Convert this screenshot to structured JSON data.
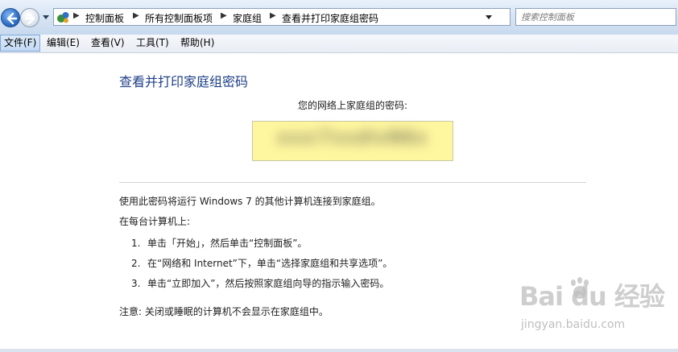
{
  "address_bar": {
    "breadcrumbs": [
      "控制面板",
      "所有控制面板项",
      "家庭组",
      "查看并打印家庭组密码"
    ],
    "search_placeholder": "搜索控制面板"
  },
  "menu": {
    "items": [
      {
        "label": "文件(F)",
        "active": true
      },
      {
        "label": "编辑(E)",
        "active": false
      },
      {
        "label": "查看(V)",
        "active": false
      },
      {
        "label": "工具(T)",
        "active": false
      },
      {
        "label": "帮助(H)",
        "active": false
      }
    ]
  },
  "content": {
    "title": "查看并打印家庭组密码",
    "password_label": "您的网络上家庭组的密码:",
    "password_value": "xxxi7xxdlxN6x",
    "intro": "使用此密码将运行 Windows 7 的其他计算机连接到家庭组。",
    "on_each": "在每台计算机上:",
    "steps": [
      {
        "num": "1.",
        "text": "单击「开始」，然后单击“控制面板”。"
      },
      {
        "num": "2.",
        "text": "在“网络和 Internet”下，单击“选择家庭组和共享选项”。"
      },
      {
        "num": "3.",
        "text": "单击“立即加入”，然后按照家庭组向导的指示输入密码。"
      }
    ],
    "note": "注意: 关闭或睡眠的计算机不会显示在家庭组中。"
  },
  "watermark": {
    "logo": "Bai  du 经验",
    "url": "jingyan.baidu.com"
  },
  "colors": {
    "title": "#1e3f86",
    "password_bg": "#fff79f"
  }
}
